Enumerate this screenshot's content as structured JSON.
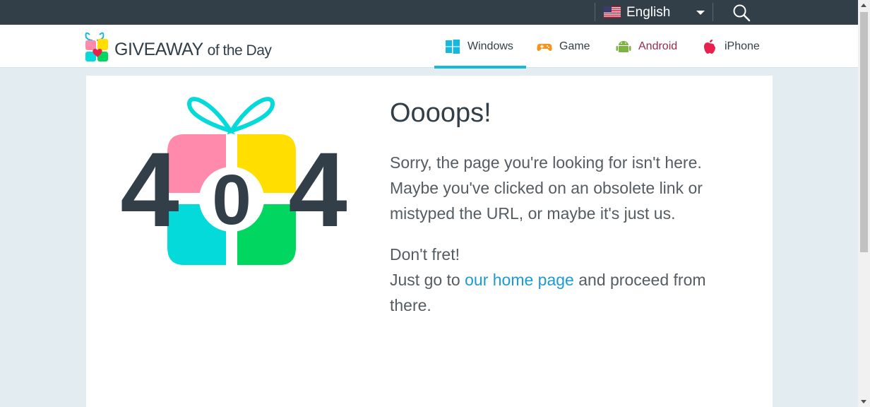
{
  "topbar": {
    "language": "English"
  },
  "header": {
    "logo_main": "GIVEAWAY",
    "logo_suffix": "of the Day",
    "nav": [
      {
        "label": "Windows",
        "active": true
      },
      {
        "label": "Game"
      },
      {
        "label": "Android"
      },
      {
        "label": "iPhone"
      }
    ]
  },
  "error": {
    "code_left": "4",
    "code_middle": "0",
    "code_right": "4",
    "title": "Oooops!",
    "line1": "Sorry, the page you're looking for isn't here.",
    "line2": "Maybe you've clicked on an obsolete link or",
    "line3": "mistyped the URL, or maybe it's just us.",
    "dont_fret": "Don't fret!",
    "just_go": "Just go to",
    "home_link": "our home page",
    "proceed": "and proceed from",
    "there": "there."
  },
  "colors": {
    "topbar": "#333f48",
    "accent": "#16b9dc",
    "link": "#1b9bd7",
    "pink": "#ff8aac",
    "yellow": "#ffde00",
    "cyan": "#05dadb",
    "green": "#00d660",
    "android_text": "#9a2a4a"
  }
}
